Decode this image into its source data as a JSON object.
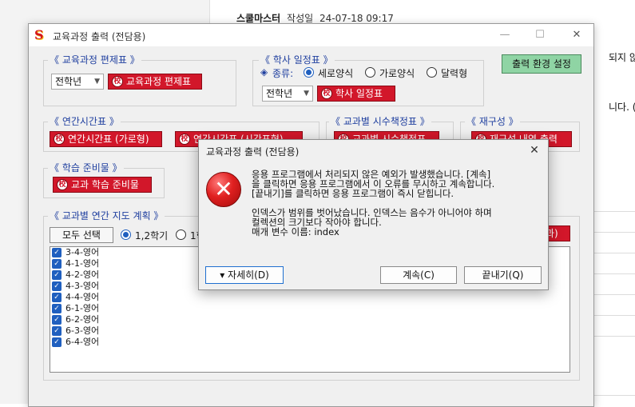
{
  "background": {
    "author": "스쿨마스터",
    "meta_label": "작성일",
    "meta_date": "24-07-18 09:17",
    "fragments": [
      "되지 않습니",
      "니다. (한글"
    ]
  },
  "window": {
    "title": "교육과정 출력 (전담용)",
    "minimize": "—",
    "maximize": "☐",
    "close": "✕"
  },
  "curriculum_table": {
    "label": "《 교육과정 편제표 》",
    "select_value": "전학년",
    "button": "교육과정 편제표"
  },
  "schedule": {
    "label": "《 학사 일정표 》",
    "kind_label": "종류:",
    "options": [
      "세로양식",
      "가로양식",
      "달력형"
    ],
    "selected": "세로양식",
    "select_value": "전학년",
    "button": "학사 일정표"
  },
  "output_settings": {
    "label": "출력 환경 설정"
  },
  "annual_timetable": {
    "label": "《 연간시간표 》",
    "buttons": [
      "연간시간표 (가로형)",
      "연간시간표 (시간표형)"
    ]
  },
  "textbook_table": {
    "label": "《 교과별 시수책정표 》",
    "button": "교과별 시수책정표"
  },
  "restructure": {
    "label": "《 재구성 》",
    "button": "재구성 내역 출력"
  },
  "learning_prep": {
    "label": "《 학습 준비물 》",
    "button": "교과 학습 준비물"
  },
  "annual_plan": {
    "label": "《 교과별 연간 지도 계획 》",
    "select_all": "모두 선택",
    "semesters": [
      "1,2학기",
      "1학"
    ],
    "right_button_fragment": "과)",
    "items": [
      "3-4-영어",
      "4-1-영어",
      "4-2-영어",
      "4-3-영어",
      "4-4-영어",
      "6-1-영어",
      "6-2-영어",
      "6-3-영어",
      "6-4-영어"
    ]
  },
  "dialog": {
    "title": "교육과정 출력 (전담용)",
    "close": "✕",
    "icon_glyph": "✕",
    "message_lines": [
      "응용 프로그램에서 처리되지 않은 예외가 발생했습니다. [계속]",
      "을 클릭하면 응용 프로그램에서 이 오류를 무시하고 계속합니다.",
      "[끝내기]를 클릭하면 응용 프로그램이 즉시 닫힙니다."
    ],
    "detail_lines": [
      "인덱스가 범위를 벗어났습니다. 인덱스는 음수가 아니어야 하며",
      "컬렉션의 크기보다 작아야 합니다.",
      "매개 변수 이름: index"
    ],
    "details_button": "▾ 자세히(D)",
    "continue_button": "계속(C)",
    "quit_button": "끝내기(Q)"
  }
}
